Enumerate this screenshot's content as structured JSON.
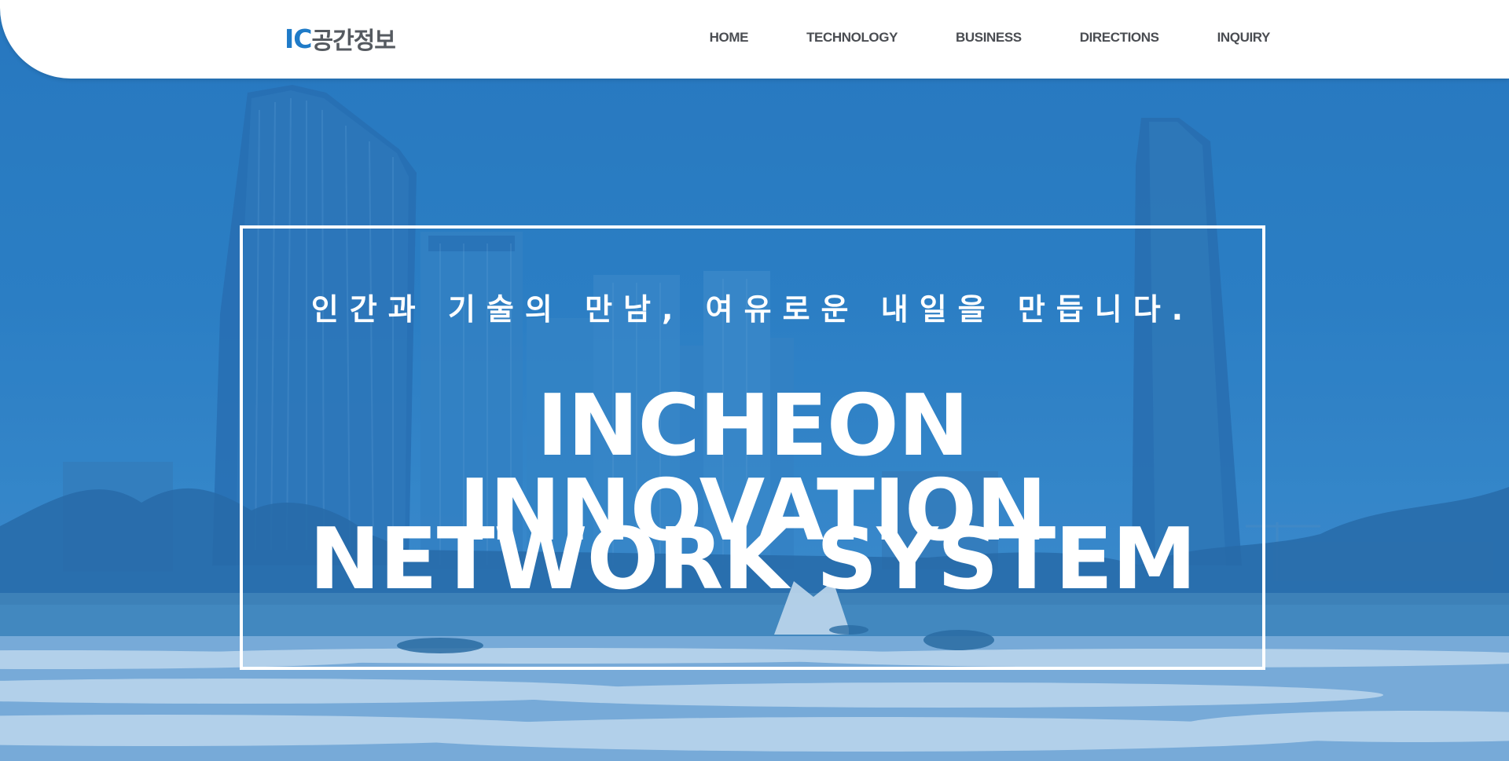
{
  "header": {
    "logo": {
      "ic": "IC",
      "name": "공간정보"
    },
    "nav": [
      {
        "label": "HOME"
      },
      {
        "label": "TECHNOLOGY"
      },
      {
        "label": "BUSINESS"
      },
      {
        "label": "DIRECTIONS"
      },
      {
        "label": "INQUIRY"
      }
    ]
  },
  "hero": {
    "tagline": "인간과 기술의 만남, 여유로운 내일을 만듭니다.",
    "headline_line1": "INCHEON INNOVATION",
    "headline_line2": "NETWORK SYSTEM"
  },
  "colors": {
    "brand_blue": "#1f7bc8",
    "hero_tint": "#2b7cc2",
    "header_bg": "#ffffff",
    "nav_text": "#4a4d52"
  }
}
